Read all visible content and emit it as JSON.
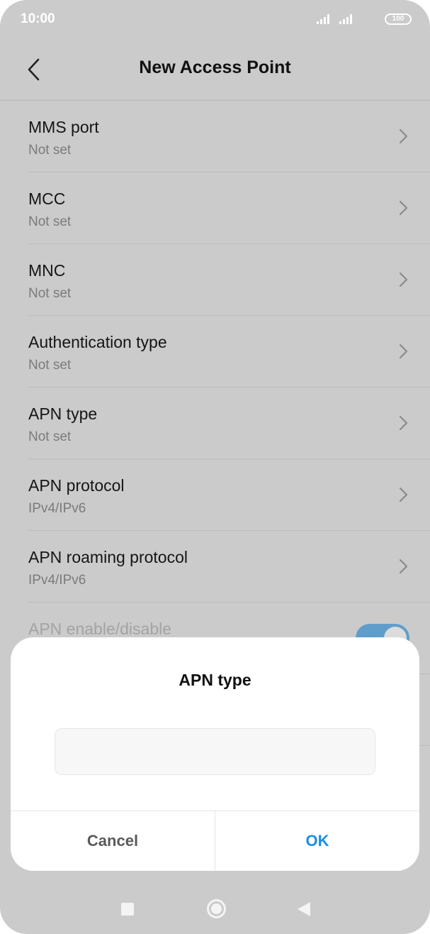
{
  "status_bar": {
    "time": "10:00",
    "battery": "100",
    "icons": [
      "signal-icon",
      "signal-icon",
      "battery-icon"
    ]
  },
  "header": {
    "title": "New Access Point",
    "back_icon": "back-arrow-icon"
  },
  "settings": {
    "items": [
      {
        "title": "MMS port",
        "value": "Not set"
      },
      {
        "title": "MCC",
        "value": "Not set"
      },
      {
        "title": "MNC",
        "value": "Not set"
      },
      {
        "title": "Authentication type",
        "value": "Not set"
      },
      {
        "title": "APN type",
        "value": "Not set"
      },
      {
        "title": "APN protocol",
        "value": "IPv4/IPv6"
      },
      {
        "title": "APN roaming protocol",
        "value": "IPv4/IPv6"
      }
    ],
    "toggle": {
      "title": "APN enable/disable",
      "enabled": true
    }
  },
  "dialog": {
    "title": "APN type",
    "input_value": "",
    "cancel_label": "Cancel",
    "ok_label": "OK"
  },
  "colors": {
    "accent": "#1b8ee6",
    "toggle_on": "#5f9ecb",
    "dim_overlay": "#cbcbcb"
  },
  "nav_bar": {
    "icons": [
      "recents-icon",
      "home-icon",
      "back-icon"
    ]
  }
}
